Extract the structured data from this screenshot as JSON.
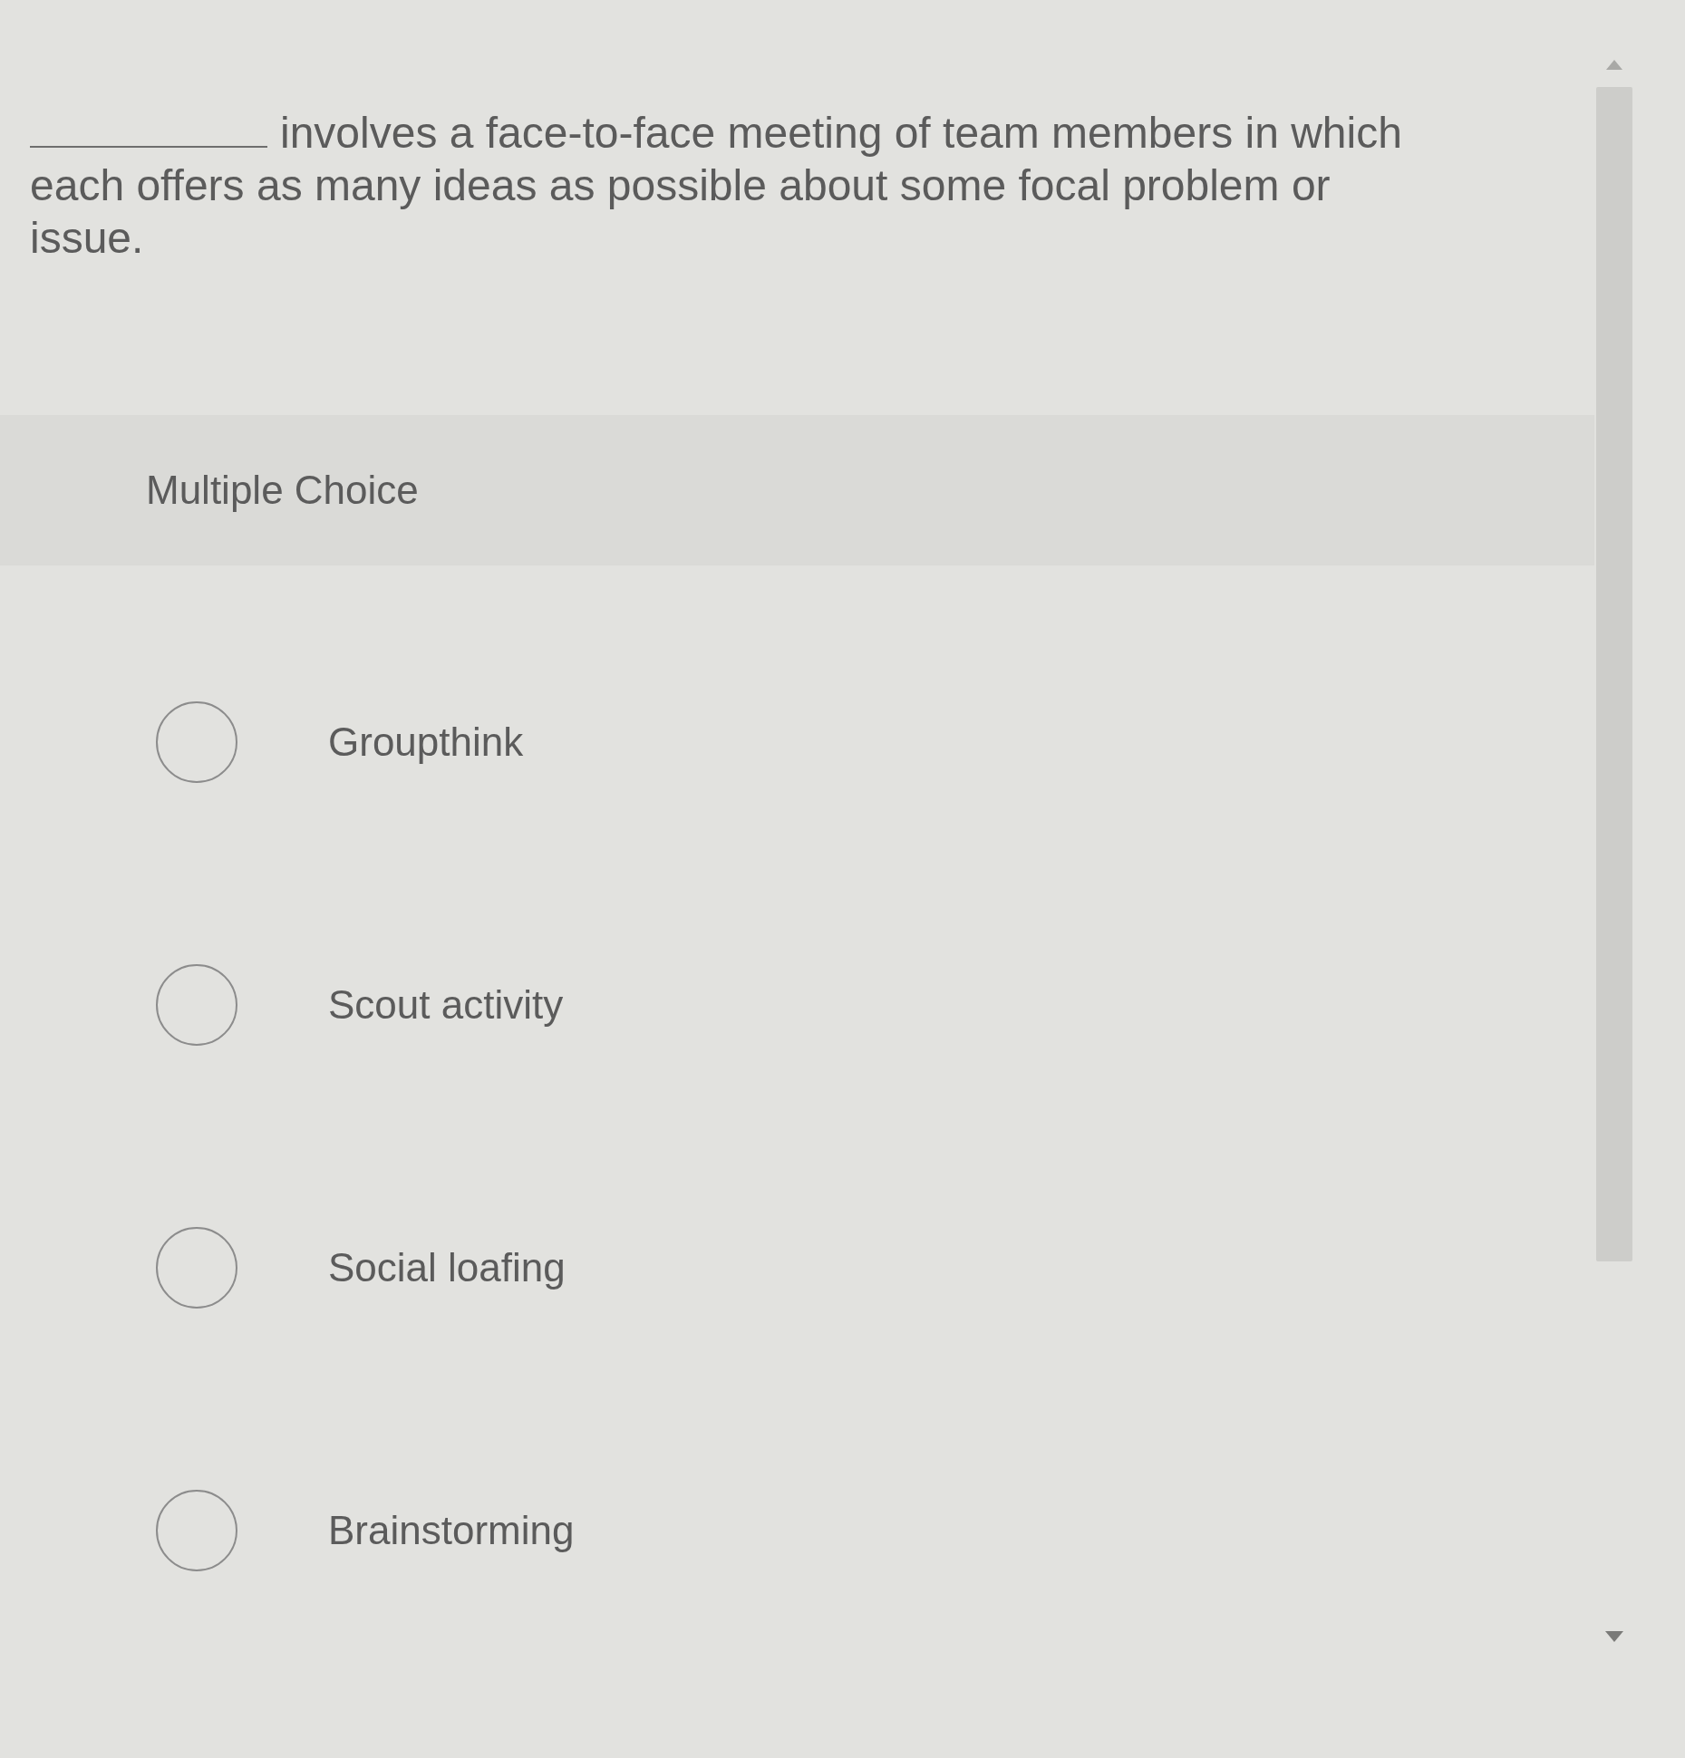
{
  "question": {
    "first_line": "involves a face-to-face meeting of team members in which",
    "continuation": "each offers as many ideas as possible about some focal problem or issue."
  },
  "question_type": "Multiple Choice",
  "options": [
    {
      "label": "Groupthink",
      "selected": false
    },
    {
      "label": "Scout activity",
      "selected": false
    },
    {
      "label": "Social loafing",
      "selected": false
    },
    {
      "label": "Brainstorming",
      "selected": false
    }
  ]
}
